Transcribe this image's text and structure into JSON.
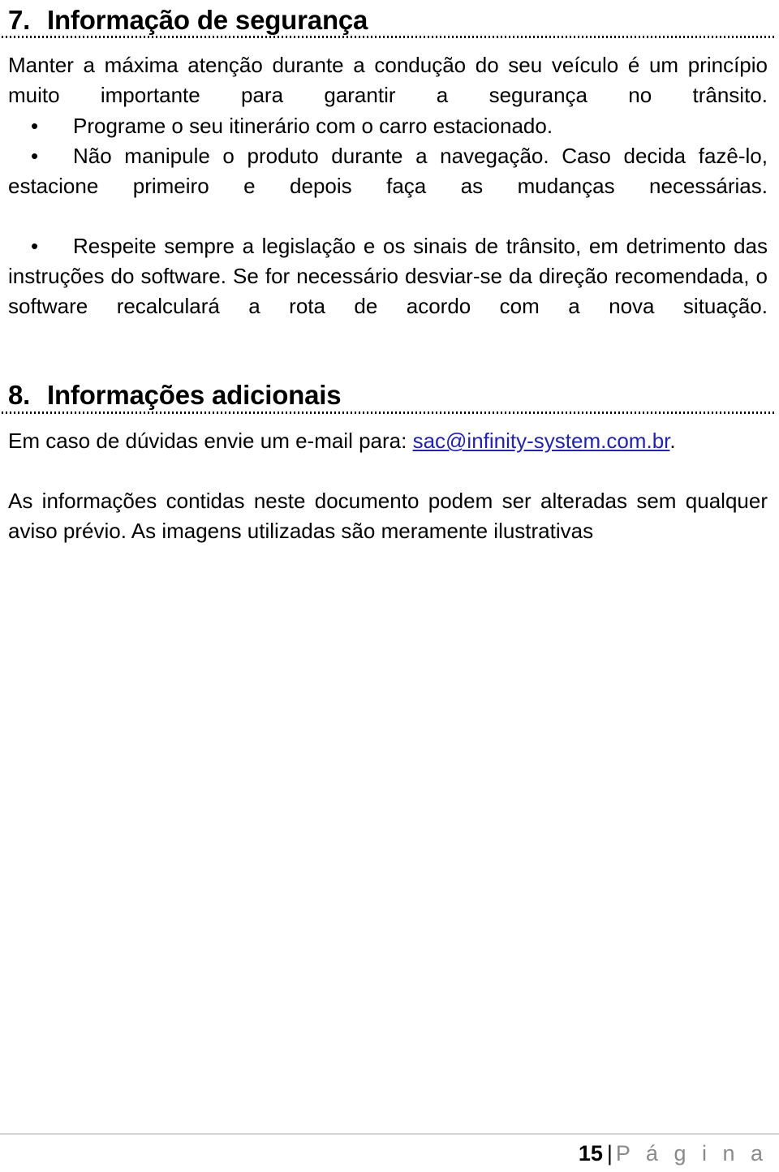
{
  "document": {
    "page_background": "#ffffff",
    "text_color": "#000000",
    "link_color": "#2222AA"
  },
  "section7": {
    "number": "7.",
    "title": "Informação de segurança",
    "intro": "Manter a máxima atenção durante a condução do seu veículo é um princípio muito importante para garantir a segurança no trânsito.",
    "bullets": [
      "Programe o seu itinerário com o carro estacionado.",
      "Não manipule o produto durante a navegação. Caso decida fazê-lo, estacione primeiro e depois faça as mudanças necessárias.",
      "Respeite sempre a legislação e os sinais de trânsito, em detrimento das instruções do software. Se for necessário desviar-se da direção recomendada, o software recalculará a rota de acordo com a nova situação."
    ]
  },
  "section8": {
    "number": "8.",
    "title": "Informações adicionais",
    "contact_prefix": "Em caso de dúvidas envie um e-mail para: ",
    "contact_email": "sac@infinity-system.com.br",
    "contact_suffix": ".",
    "disclaimer": "As informações contidas neste documento podem ser alteradas sem qualquer aviso prévio. As imagens utilizadas são meramente ilustrativas"
  },
  "footer": {
    "page_number": "15",
    "separator": "|",
    "page_label": "P á g i n a"
  }
}
